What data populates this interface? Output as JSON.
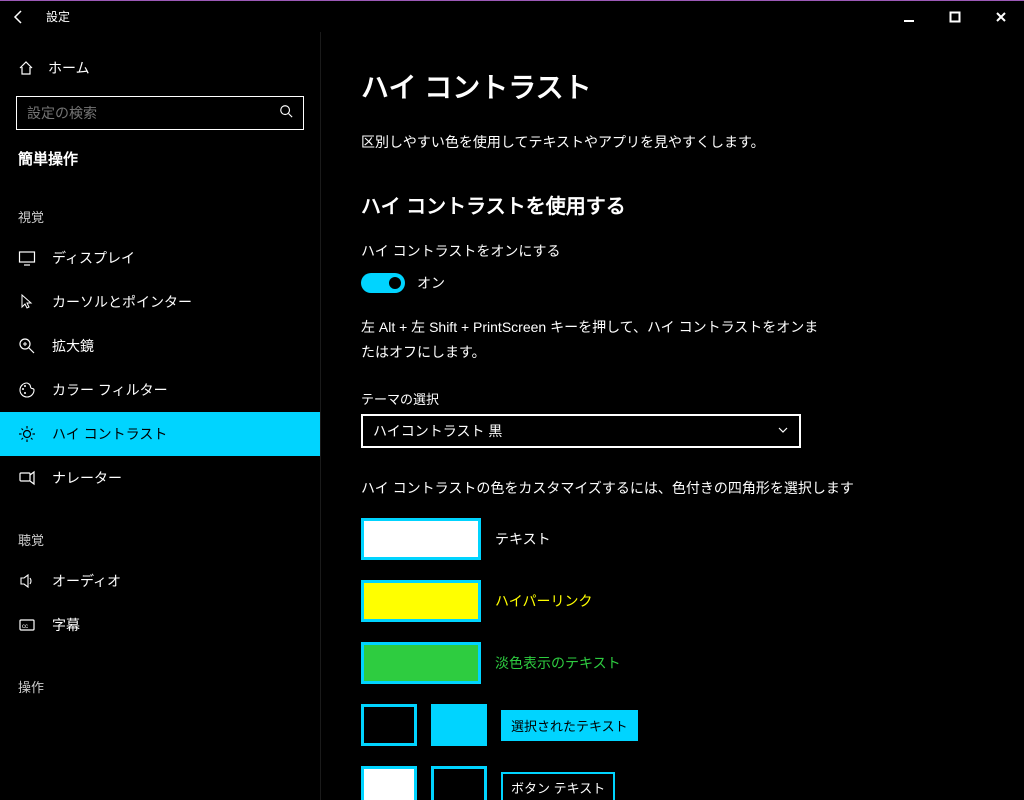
{
  "titlebar": {
    "title": "設定"
  },
  "sidebar": {
    "home": "ホーム",
    "search_placeholder": "設定の検索",
    "group": "簡単操作",
    "categories": {
      "visual": "視覚",
      "hearing": "聴覚",
      "interaction": "操作"
    },
    "items": [
      {
        "label": "ディスプレイ"
      },
      {
        "label": "カーソルとポインター"
      },
      {
        "label": "拡大鏡"
      },
      {
        "label": "カラー フィルター"
      },
      {
        "label": "ハイ コントラスト"
      },
      {
        "label": "ナレーター"
      }
    ],
    "audio": "オーディオ",
    "captions": "字幕"
  },
  "main": {
    "title": "ハイ コントラスト",
    "description": "区別しやすい色を使用してテキストやアプリを見やすくします。",
    "use_heading": "ハイ コントラストを使用する",
    "toggle_label": "ハイ コントラストをオンにする",
    "toggle_state": "オン",
    "shortcut_hint": "左 Alt + 左 Shift + PrintScreen キーを押して、ハイ コントラストをオンまたはオフにします。",
    "theme_label": "テーマの選択",
    "theme_value": "ハイコントラスト 黒",
    "customize_label": "ハイ コントラストの色をカスタマイズするには、色付きの四角形を選択します",
    "swatches": {
      "text": {
        "label": "テキスト",
        "color": "#ffffff",
        "label_color": "#ffffff"
      },
      "hyperlink": {
        "label": "ハイパーリンク",
        "color": "#ffff00",
        "label_color": "#ffff00"
      },
      "disabled": {
        "label": "淡色表示のテキスト",
        "color": "#2ecc40",
        "label_color": "#2ecc40"
      },
      "selected": {
        "label": "選択されたテキスト",
        "fg": "#000000",
        "bg": "#00d4ff"
      },
      "button": {
        "label": "ボタン テキスト",
        "fg": "#ffffff",
        "bg": "#000000"
      }
    }
  }
}
